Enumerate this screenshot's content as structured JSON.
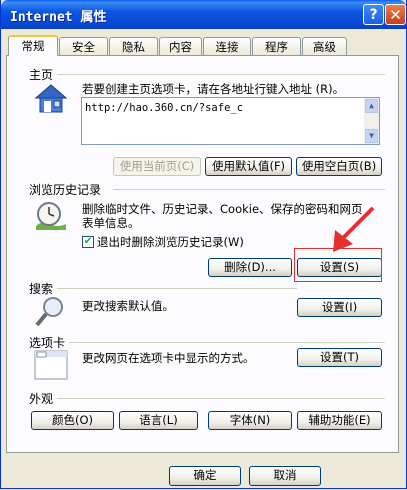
{
  "window": {
    "title": "Internet 属性",
    "help": "?",
    "close": "✕"
  },
  "tabs": [
    {
      "label": "常规"
    },
    {
      "label": "安全"
    },
    {
      "label": "隐私"
    },
    {
      "label": "内容"
    },
    {
      "label": "连接"
    },
    {
      "label": "程序"
    },
    {
      "label": "高级"
    }
  ],
  "homepage": {
    "heading": "主页",
    "description": "若要创建主页选项卡，请在各地址行键入地址 (R)。",
    "url": "http://hao.360.cn/?safe_c",
    "use_current": "使用当前页(C)",
    "use_default": "使用默认值(F)",
    "use_blank": "使用空白页(B)"
  },
  "history": {
    "heading": "浏览历史记录",
    "description_1": "删除临时文件、历史记录、Cookie、保存的密码和网页",
    "description_2": "表单信息。",
    "checkbox_label": "退出时删除浏览历史记录(W)",
    "delete_button": "删除(D)...",
    "settings_button": "设置(S)"
  },
  "search": {
    "heading": "搜索",
    "description": "更改搜索默认值。",
    "settings_button": "设置(I)"
  },
  "tabs_section": {
    "heading": "选项卡",
    "description": "更改网页在选项卡中显示的方式。",
    "settings_button": "设置(T)"
  },
  "appearance": {
    "heading": "外观",
    "colors": "颜色(O)",
    "languages": "语言(L)",
    "fonts": "字体(N)",
    "accessibility": "辅助功能(E)"
  },
  "footer": {
    "ok": "确定",
    "cancel": "取消"
  },
  "colors": {
    "title_bar": "#0845d0",
    "annotation": "#e53030"
  }
}
